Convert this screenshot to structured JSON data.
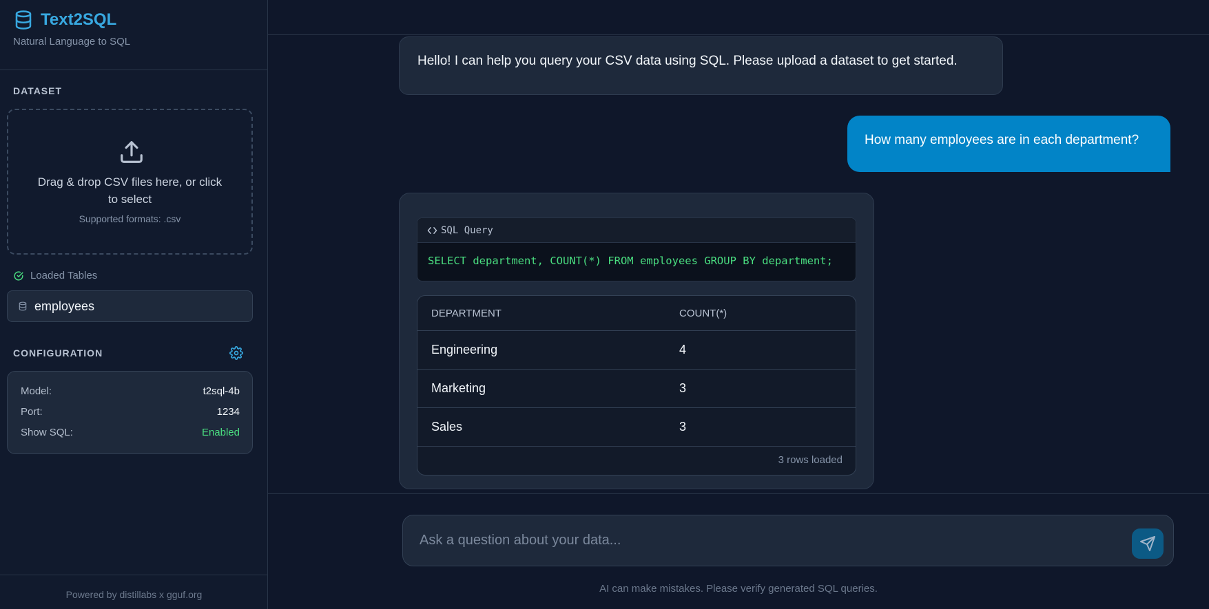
{
  "sidebar": {
    "brand_title": "Text2SQL",
    "brand_subtitle": "Natural Language to SQL",
    "dataset_label": "DATASET",
    "dropzone_text": "Drag & drop CSV files here, or click to select",
    "dropzone_formats": "Supported formats: .csv",
    "loaded_tables_label": "Loaded Tables",
    "tables": [
      "employees"
    ],
    "config_label": "CONFIGURATION",
    "config": [
      {
        "key": "Model:",
        "value": "t2sql-4b"
      },
      {
        "key": "Port:",
        "value": "1234"
      },
      {
        "key": "Show SQL:",
        "value": "Enabled"
      }
    ],
    "powered_by": "Powered by distillabs x gguf.org"
  },
  "chat": {
    "bot_greeting": "Hello! I can help you query your CSV data using SQL. Please upload a dataset to get started.",
    "user_question": "How many employees are in each department?",
    "sql_label": "SQL Query",
    "sql_code": "SELECT department, COUNT(*) FROM employees GROUP BY department;",
    "result": {
      "columns": [
        "DEPARTMENT",
        "COUNT(*)"
      ],
      "rows": [
        [
          "Engineering",
          "4"
        ],
        [
          "Marketing",
          "3"
        ],
        [
          "Sales",
          "3"
        ]
      ],
      "footer": "3 rows loaded"
    }
  },
  "input": {
    "placeholder": "Ask a question about your data...",
    "disclaimer": "AI can make mistakes. Please verify generated SQL queries."
  },
  "colors": {
    "accent": "#38a8e0",
    "user_bubble": "#0284c7",
    "sql_text": "#4ade80",
    "enabled": "#4ade80"
  }
}
